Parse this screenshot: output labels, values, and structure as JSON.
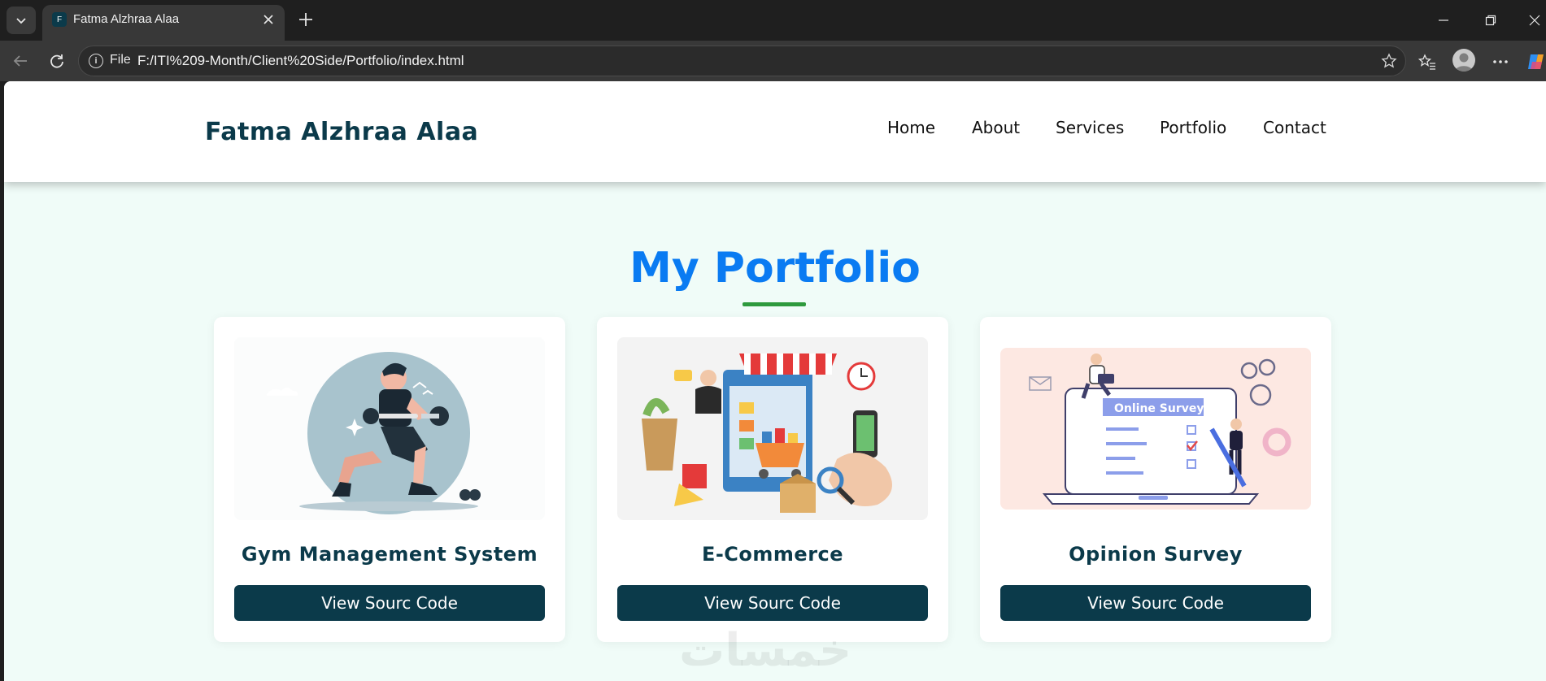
{
  "browser": {
    "tab_title": "Fatma Alzhraa Alaa",
    "favicon_letter": "F",
    "file_label": "File",
    "url": "F:/ITI%209-Month/Client%20Side/Portfolio/index.html"
  },
  "site": {
    "brand": "Fatma Alzhraa Alaa",
    "nav": [
      "Home",
      "About",
      "Services",
      "Portfolio",
      "Contact"
    ]
  },
  "portfolio": {
    "title": "My Portfolio",
    "projects": [
      {
        "title": "Gym Management System",
        "button": "View Sourc Code",
        "image": "gym-illustration"
      },
      {
        "title": "E-Commerce",
        "button": "View Sourc Code",
        "image": "ecommerce-illustration"
      },
      {
        "title": "Opinion Survey",
        "button": "View Sourc Code",
        "image": "survey-illustration"
      }
    ],
    "survey_image_text": "Online Survey"
  },
  "watermark": "خمسات",
  "colors": {
    "brand": "#0b3a4a",
    "title": "#0a7bf2",
    "underline": "#2e9a3e",
    "page_bg": "#f0fcf8"
  }
}
